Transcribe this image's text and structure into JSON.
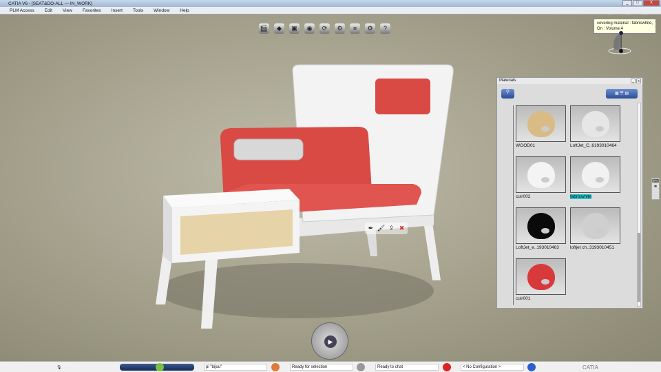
{
  "window": {
    "title": "CATIA V6 - [SEAT&DO-ALL --- IN_WORK]",
    "buttons": [
      "_",
      "□",
      "X"
    ]
  },
  "menu": [
    "PLM Access",
    "Edit",
    "View",
    "Favorites",
    "Insert",
    "Tools",
    "Window",
    "Help"
  ],
  "toolbar_icons": [
    "clapper-icon",
    "render-icon",
    "image-icon",
    "camera-icon",
    "turntable-icon",
    "gear-icon",
    "stack-icon",
    "settings-icon",
    "help-icon"
  ],
  "tooltip": {
    "line1": "covering material : fabricwhite,",
    "line2": "On : Volume.4"
  },
  "materials_panel": {
    "title": "Materials",
    "view_buttons": [
      "grid-view-icon",
      "list-view-icon",
      "detail-view-icon"
    ],
    "items": [
      {
        "label": "WOOD01",
        "color": "#d9bc85",
        "selected": false
      },
      {
        "label": "LoftJet_C..6193010464",
        "color": "#e6e6e6",
        "selected": false
      },
      {
        "label": "cuir002",
        "color": "#f4f4f4",
        "selected": false
      },
      {
        "label": "fabricwhite",
        "color": "#f1f1f1",
        "selected": true
      },
      {
        "label": "LoftJet_e..193010463",
        "color": "#0a0a0a",
        "selected": false
      },
      {
        "label": "loftjet ch..3193010451",
        "color": "#cfcfcf",
        "selected": false
      },
      {
        "label": "cuir001",
        "color": "#d8393a",
        "selected": false
      }
    ]
  },
  "status": {
    "field1": "pi \"bijou\"",
    "field2": "Ready for selection",
    "field3": "Ready to chat",
    "field4": "< No Configuration >",
    "brand": "CATIA"
  },
  "colors": {
    "accent": "#2c4c96",
    "selection": "#27c4c8",
    "seat_red": "#d94a45"
  }
}
